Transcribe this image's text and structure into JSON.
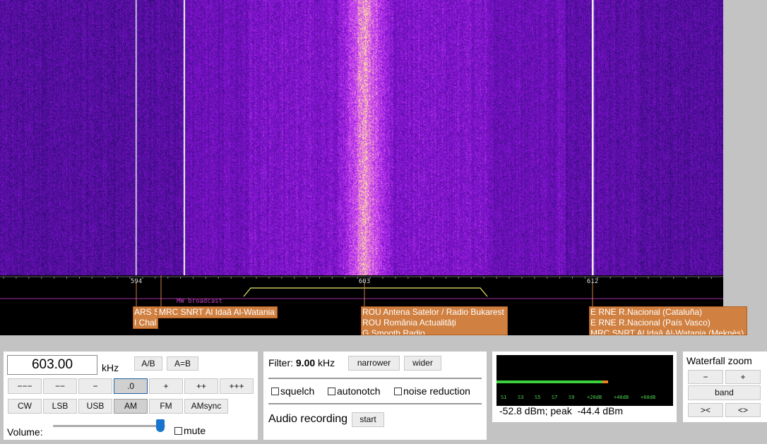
{
  "spectrum": {
    "ticks": [
      {
        "label": "594",
        "freq": 594
      },
      {
        "label": "603",
        "freq": 603
      },
      {
        "label": "612",
        "freq": 612
      }
    ],
    "band_label": "MW broadcast",
    "station_groups": [
      {
        "lines": [
          "ARS S",
          "I Chal"
        ]
      },
      {
        "lines": [
          "MRC SNRT Al Idaâ Al-Watania"
        ]
      },
      {
        "lines": [
          "ROU Antena Satelor / Radio Bukarest",
          "ROU România Actualități",
          "G Smooth Radio"
        ]
      },
      {
        "lines": [
          "E RNE R.Nacional (Cataluña)",
          "E RNE R.Nacional (País Vasco)",
          "MRC SNRT Al Idaâ Al-Watania (Meknès)"
        ]
      }
    ]
  },
  "tuning": {
    "frequency": "603.00",
    "unit": "kHz",
    "ab_label": "A/B",
    "a_eq_b_label": "A=B",
    "step_buttons": [
      "−−−",
      "−−",
      "−",
      ".0",
      "+",
      "++",
      "+++"
    ],
    "active_step": ".0",
    "modes": [
      "CW",
      "LSB",
      "USB",
      "AM",
      "FM",
      "AMsync"
    ],
    "active_mode": "AM",
    "volume_label": "Volume:",
    "volume_level": 0.95,
    "mute_label": "mute"
  },
  "filter": {
    "label": "Filter:",
    "value": "9.00",
    "unit": "kHz",
    "narrower_label": "narrower",
    "wider_label": "wider",
    "squelch_label": "squelch",
    "autonotch_label": "autonotch",
    "noise_reduction_label": "noise reduction",
    "audio_recording_label": "Audio recording",
    "start_label": "start"
  },
  "smeter": {
    "scale_labels": [
      "S1",
      "S3",
      "S5",
      "S7",
      "S9",
      "+20dB",
      "+40dB",
      "+60dB"
    ],
    "level_fraction": 0.6,
    "peak_fraction": 0.63,
    "reading": "-52.8 dBm; peak  -44.4 dBm",
    "colors": {
      "level": "#3cd03c",
      "peak": "#f08020"
    }
  },
  "zoom": {
    "title": "Waterfall zoom",
    "minus_label": "−",
    "plus_label": "+",
    "band_label": "band",
    "narrow_label": "><",
    "wide_label": "<>"
  }
}
